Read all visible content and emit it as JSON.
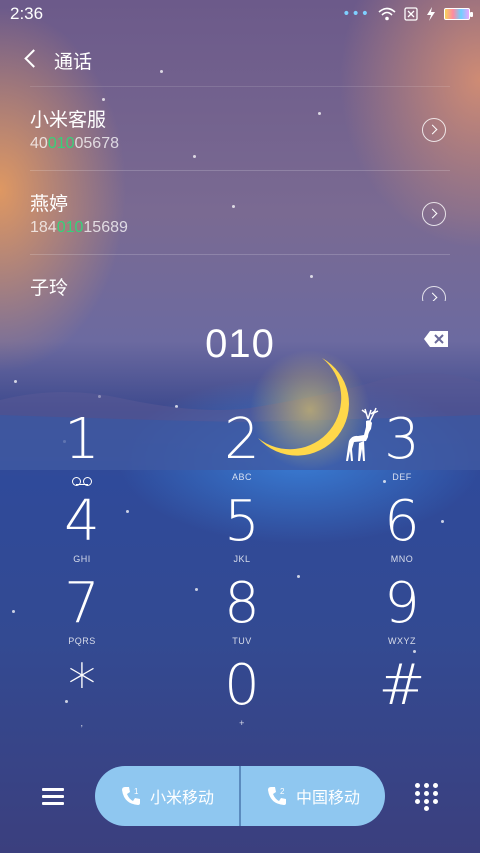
{
  "status_bar": {
    "time": "2:36",
    "dots": "•••"
  },
  "header": {
    "title": "通话"
  },
  "contacts": [
    {
      "name": "小米客服",
      "number_pre": "40",
      "number_match": "010",
      "number_post": "05678"
    },
    {
      "name": "燕婷",
      "number_pre": "184",
      "number_match": "010",
      "number_post": "15689"
    },
    {
      "name": "子玲",
      "number_pre": "",
      "number_match": "",
      "number_post": ""
    }
  ],
  "dial": {
    "number": "010"
  },
  "keypad": [
    {
      "digit": "1",
      "letters": ""
    },
    {
      "digit": "2",
      "letters": "ABC"
    },
    {
      "digit": "3",
      "letters": "DEF"
    },
    {
      "digit": "4",
      "letters": "GHI"
    },
    {
      "digit": "5",
      "letters": "JKL"
    },
    {
      "digit": "6",
      "letters": "MNO"
    },
    {
      "digit": "7",
      "letters": "PQRS"
    },
    {
      "digit": "8",
      "letters": "TUV"
    },
    {
      "digit": "9",
      "letters": "WXYZ"
    },
    {
      "digit": "*",
      "letters": ","
    },
    {
      "digit": "0",
      "letters": "+"
    },
    {
      "digit": "#",
      "letters": ""
    }
  ],
  "sim": [
    {
      "label": "小米移动",
      "slot": "1"
    },
    {
      "label": "中国移动",
      "slot": "2"
    }
  ],
  "colors": {
    "match_highlight": "#35d27a",
    "sim_button": "#8fc7f0",
    "moon": "#ffd84a"
  }
}
